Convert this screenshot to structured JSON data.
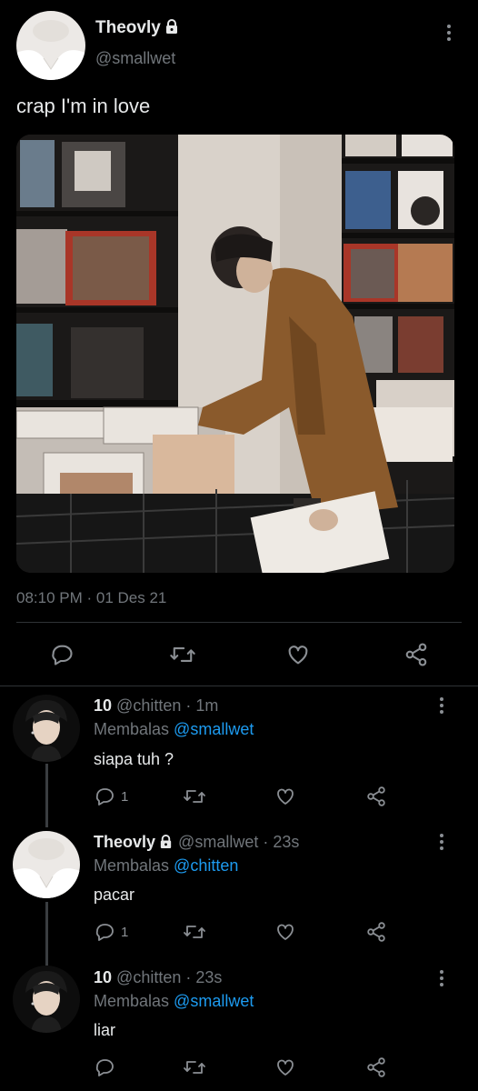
{
  "main_tweet": {
    "display_name": "Theovly",
    "handle": "@smallwet",
    "text": "crap I'm in love",
    "timestamp": "08:10 PM · 01 Des 21"
  },
  "replies": [
    {
      "display_name": "10",
      "handle": "@chitten",
      "time": "· 1m",
      "replying_label": "Membalas",
      "replying_to": "@smallwet",
      "text": "siapa tuh ?",
      "reply_count": "1"
    },
    {
      "display_name": "Theovly",
      "handle": "@smallwet",
      "time": "· 23s",
      "replying_label": "Membalas",
      "replying_to": "@chitten",
      "text": "pacar",
      "reply_count": "1"
    },
    {
      "display_name": "10",
      "handle": "@chitten",
      "time": "· 23s",
      "replying_label": "Membalas",
      "replying_to": "@smallwet",
      "text": "liar",
      "reply_count": ""
    }
  ],
  "icons": {
    "reply": "reply-icon",
    "retweet": "retweet-icon",
    "like": "heart-icon",
    "share": "share-icon",
    "more": "more-options-icon",
    "protected": "lock-icon"
  },
  "colors": {
    "background": "#000000",
    "text": "#e7e9ea",
    "muted": "#71767b",
    "link": "#1d9bf0"
  }
}
